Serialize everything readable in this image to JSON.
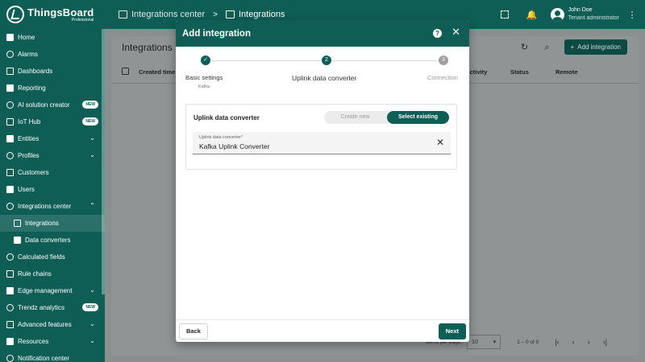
{
  "app": {
    "logo_title": "ThingsBoard",
    "logo_sub": "Professional"
  },
  "breadcrumb": [
    {
      "label": "Integrations center"
    },
    {
      "label": "Integrations"
    }
  ],
  "breadcrumb_sep": ">",
  "user": {
    "name": "John Doe",
    "role": "Tenant administrator"
  },
  "sidebar": {
    "items": [
      {
        "label": "Home",
        "icon": "home-icon"
      },
      {
        "label": "Alarms",
        "icon": "alarm-icon"
      },
      {
        "label": "Dashboards",
        "icon": "dashboard-icon"
      },
      {
        "label": "Reporting",
        "icon": "report-icon"
      },
      {
        "label": "AI solution creator",
        "icon": "ai-icon",
        "badge": "NEW"
      },
      {
        "label": "IoT Hub",
        "icon": "hub-icon",
        "badge": "NEW"
      },
      {
        "label": "Entities",
        "icon": "entities-icon",
        "chevron": "down"
      },
      {
        "label": "Profiles",
        "icon": "profiles-icon",
        "chevron": "down"
      },
      {
        "label": "Customers",
        "icon": "customers-icon"
      },
      {
        "label": "Users",
        "icon": "users-icon"
      },
      {
        "label": "Integrations center",
        "icon": "integrations-center-icon",
        "chevron": "up"
      },
      {
        "label": "Integrations",
        "icon": "integrations-icon",
        "sub": true,
        "active": true
      },
      {
        "label": "Data converters",
        "icon": "converters-icon",
        "sub": true
      },
      {
        "label": "Calculated fields",
        "icon": "calc-icon"
      },
      {
        "label": "Rule chains",
        "icon": "rule-chain-icon"
      },
      {
        "label": "Edge management",
        "icon": "edge-icon",
        "chevron": "down"
      },
      {
        "label": "Trendz analytics",
        "icon": "trendz-icon",
        "badge": "NEW"
      },
      {
        "label": "Advanced features",
        "icon": "advanced-icon",
        "chevron": "down"
      },
      {
        "label": "Resources",
        "icon": "resources-icon",
        "chevron": "down"
      },
      {
        "label": "Notification center",
        "icon": "notification-icon"
      }
    ]
  },
  "page": {
    "title": "Integrations",
    "add_button": "Add integration",
    "columns": [
      "Created time",
      "ily activity",
      "Status",
      "Remote"
    ],
    "items_per_page_label": "Items per page:",
    "items_per_page_value": "10",
    "range": "1 – 0 of 0"
  },
  "dialog": {
    "title": "Add integration",
    "steps": [
      {
        "number": "1",
        "label": "Basic settings",
        "sub": "Kafka",
        "state": "done"
      },
      {
        "number": "2",
        "label": "Uplink data converter",
        "sub": "",
        "state": "active"
      },
      {
        "number": "3",
        "label": "Connection",
        "sub": "",
        "state": "todo"
      }
    ],
    "section_label": "Uplink data converter",
    "toggle": {
      "create_new": "Create new",
      "select_existing": "Select existing",
      "selected": "select_existing"
    },
    "field": {
      "label": "Uplink data converter*",
      "value": "Kafka Uplink Converter"
    },
    "back_label": "Back",
    "next_label": "Next"
  },
  "colors": {
    "primary": "#0e5e55",
    "primary_dark": "#0c4a44",
    "step_todo": "#9e9e9e"
  }
}
